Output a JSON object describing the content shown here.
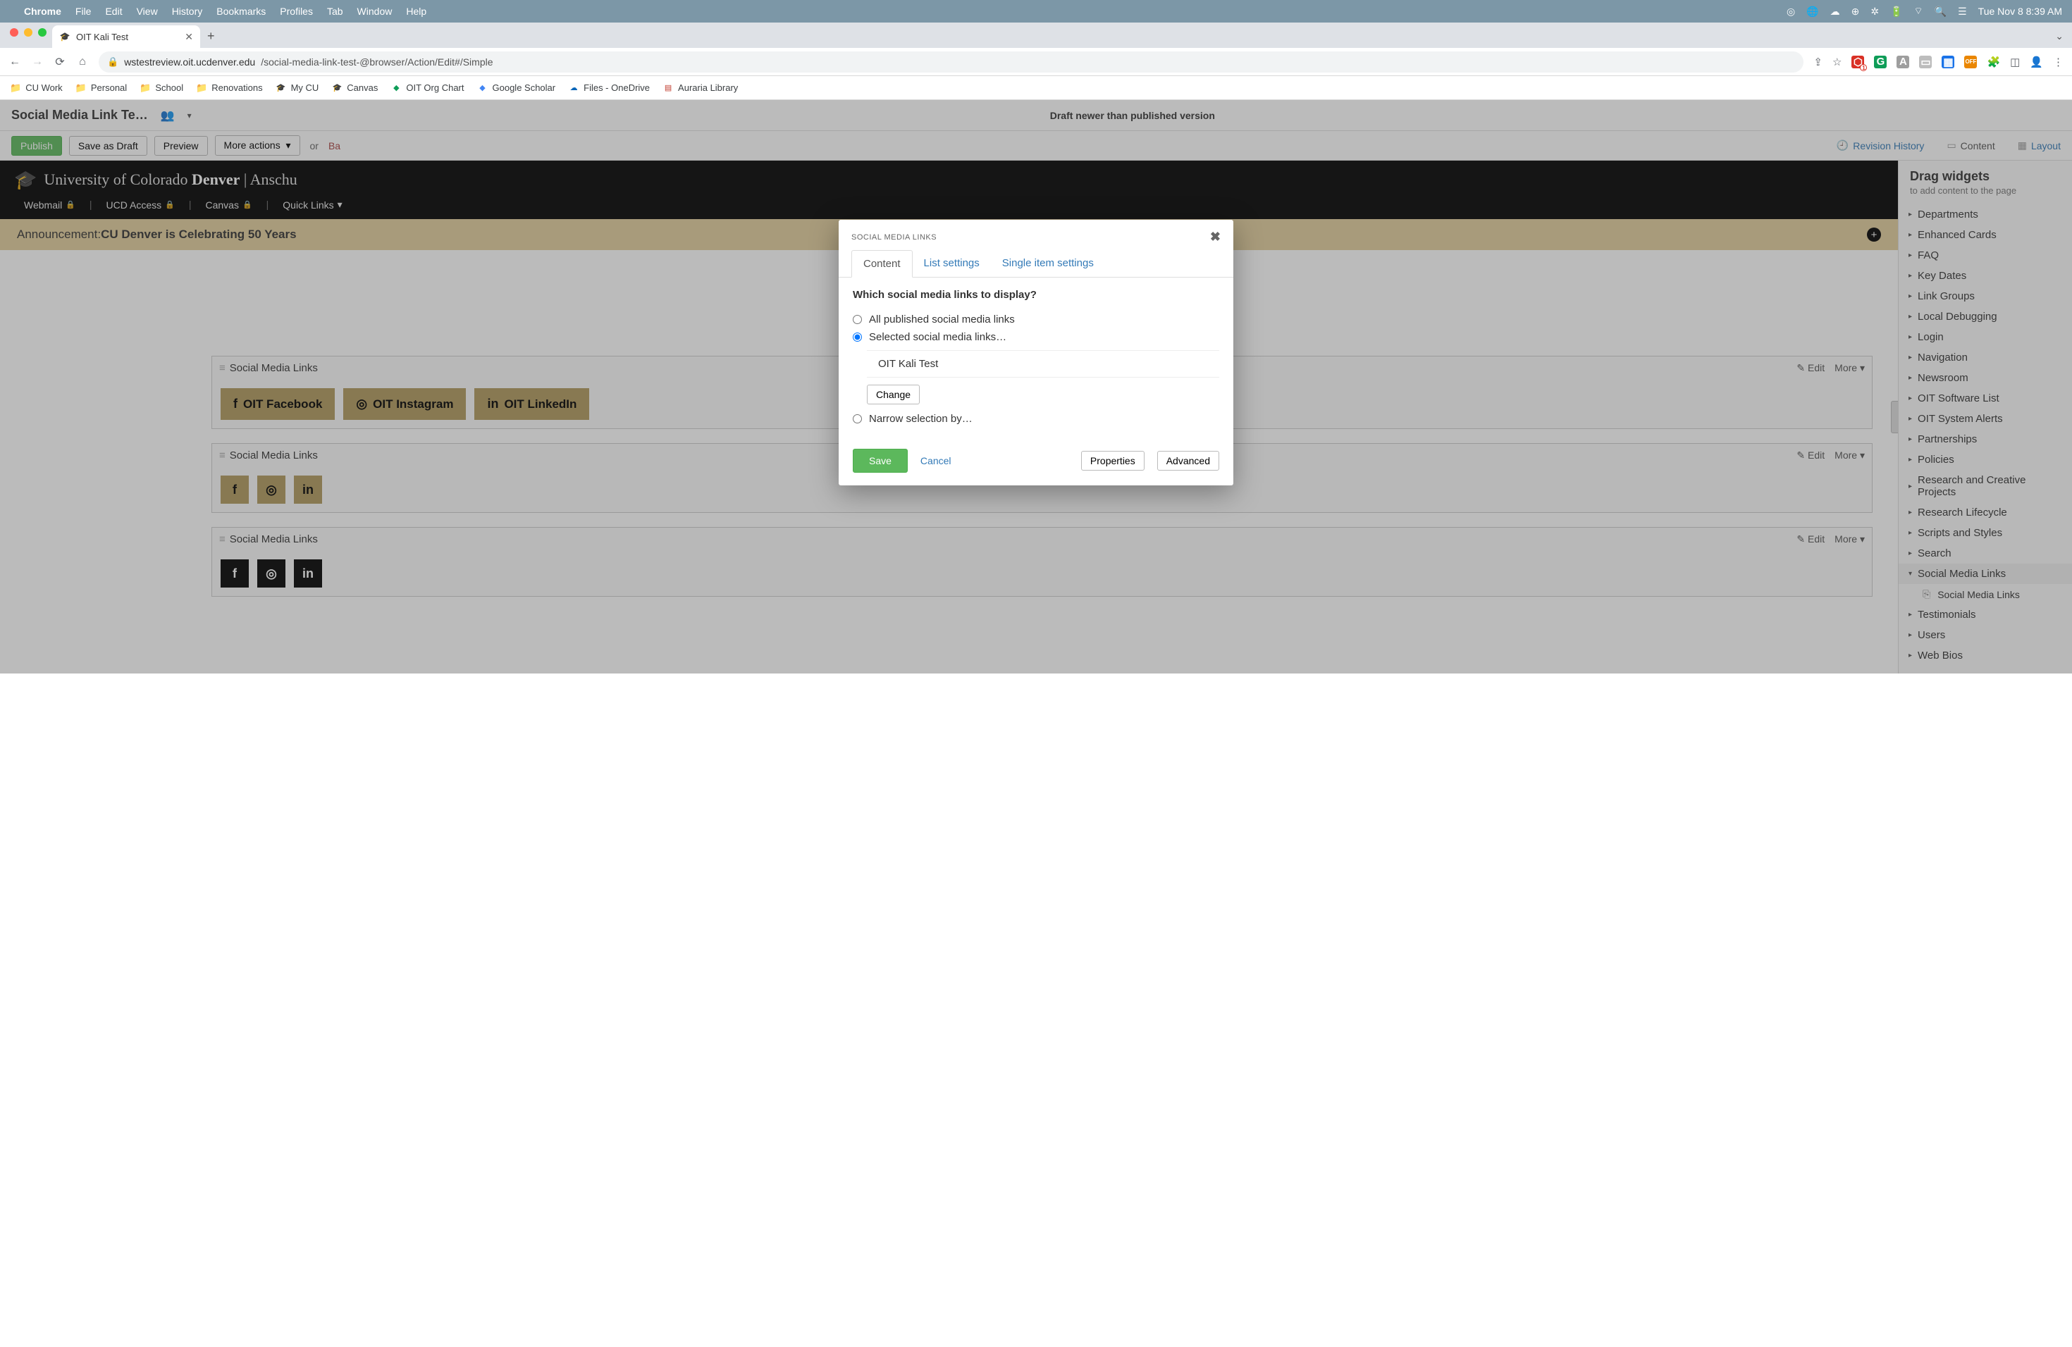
{
  "menubar": {
    "app": "Chrome",
    "items": [
      "File",
      "Edit",
      "View",
      "History",
      "Bookmarks",
      "Profiles",
      "Tab",
      "Window",
      "Help"
    ],
    "clock": "Tue Nov 8  8:39 AM"
  },
  "tab": {
    "title": "OIT Kali Test"
  },
  "omnibox": {
    "host": "wstestreview.oit.ucdenver.edu",
    "path": "/social-media-link-test-@browser/Action/Edit#/Simple"
  },
  "bookmarks": [
    "CU Work",
    "Personal",
    "School",
    "Renovations",
    "My CU",
    "Canvas",
    "OIT Org Chart",
    "Google Scholar",
    "Files - OneDrive",
    "Auraria Library"
  ],
  "cms": {
    "page_title": "Social Media Link Te…",
    "draft_msg": "Draft newer than published version",
    "actions": {
      "publish": "Publish",
      "save_draft": "Save as Draft",
      "preview": "Preview",
      "more": "More actions",
      "or": "or",
      "back": "Ba",
      "revision": "Revision History",
      "content": "Content",
      "layout": "Layout"
    }
  },
  "site": {
    "cu_light": "University of Colorado ",
    "cu_bold": "Denver",
    "cu_sep": " | Anschu",
    "subnav": [
      "Webmail",
      "UCD Access",
      "Canvas",
      "Quick Links"
    ],
    "announce_label": "Announcement: ",
    "announce_bold": "CU Denver is Celebrating 50 Years"
  },
  "widgets": {
    "block_title": "Social Media Links",
    "edit": "Edit",
    "more": "More",
    "buttons": [
      {
        "icon": "f",
        "label": "OIT Facebook"
      },
      {
        "icon": "ig",
        "label": "OIT Instagram"
      },
      {
        "icon": "in",
        "label": "OIT LinkedIn"
      }
    ]
  },
  "sidebar": {
    "title": "Drag widgets",
    "sub": "to add content to the page",
    "cats": [
      "Departments",
      "Enhanced Cards",
      "FAQ",
      "Key Dates",
      "Link Groups",
      "Local Debugging",
      "Login",
      "Navigation",
      "Newsroom",
      "OIT Software List",
      "OIT System Alerts",
      "Partnerships",
      "Policies",
      "Research and Creative Projects",
      "Research Lifecycle",
      "Scripts and Styles",
      "Search",
      "Social Media Links",
      "Testimonials",
      "Users",
      "Web Bios"
    ],
    "open_cat": "Social Media Links",
    "sub_item": "Social Media Links"
  },
  "modal": {
    "title": "SOCIAL MEDIA LINKS",
    "tabs": {
      "content": "Content",
      "list": "List settings",
      "single": "Single item settings"
    },
    "question": "Which social media links to display?",
    "opt_all": "All published social media links",
    "opt_selected": "Selected social media links…",
    "selected_item": "OIT Kali Test",
    "change": "Change",
    "opt_narrow": "Narrow selection by…",
    "save": "Save",
    "cancel": "Cancel",
    "properties": "Properties",
    "advanced": "Advanced"
  }
}
